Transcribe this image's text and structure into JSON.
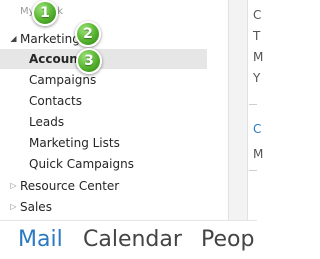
{
  "folder_tree": {
    "top_label": "My Work",
    "marketing": {
      "label": "Marketing",
      "expander": "◢",
      "children": [
        {
          "label": "Accounts"
        },
        {
          "label": "Campaigns"
        },
        {
          "label": "Contacts"
        },
        {
          "label": "Leads"
        },
        {
          "label": "Marketing Lists"
        },
        {
          "label": "Quick Campaigns"
        }
      ]
    },
    "resource_center": {
      "label": "Resource Center",
      "expander": "▷"
    },
    "sales": {
      "label": "Sales",
      "expander": "▷"
    }
  },
  "callouts": [
    "1",
    "2",
    "3"
  ],
  "reading_pane_letters": [
    "C",
    "T",
    "M",
    "Y",
    "C",
    "M"
  ],
  "bottom_nav": {
    "items": [
      "Mail",
      "Calendar",
      "Peop"
    ],
    "active": "Mail"
  },
  "colors": {
    "accent": "#2b79c2",
    "callout_green": "#54b22e",
    "selection": "#e6e6e6"
  }
}
